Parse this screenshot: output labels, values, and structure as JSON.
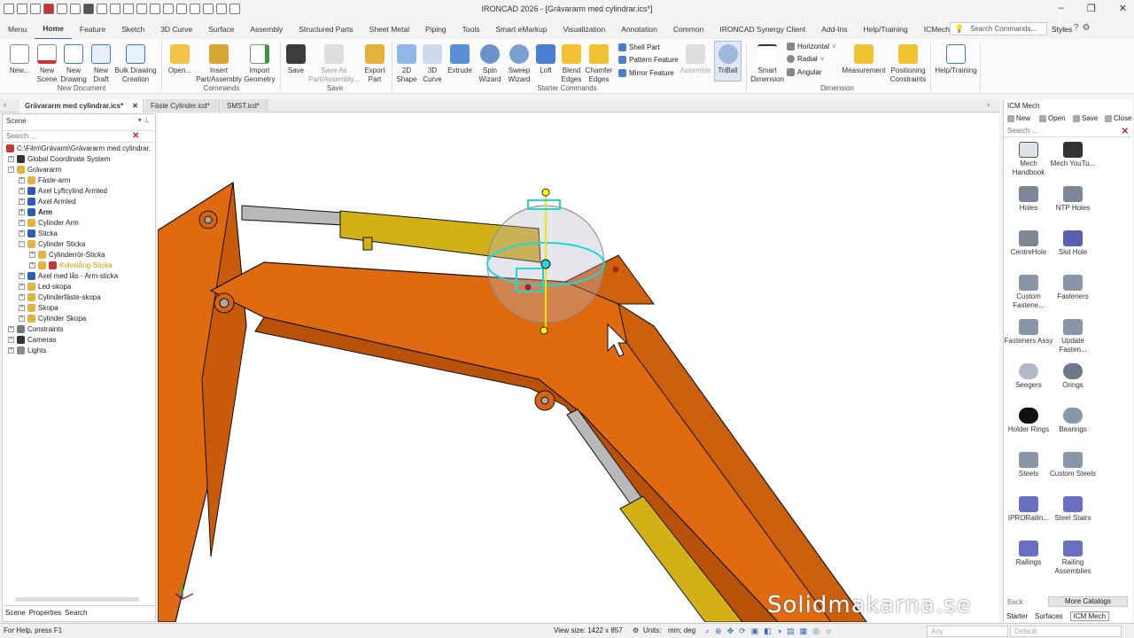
{
  "app": {
    "title": "IRONCAD 2026 - [Grävararm med cylindrar.ics*]"
  },
  "ribbon_tabs": [
    "Menu",
    "Home",
    "Feature",
    "Sketch",
    "3D Curve",
    "Surface",
    "Assembly",
    "Structured Parts",
    "Sheet Metal",
    "Piping",
    "Tools",
    "Smart eMarkup",
    "Visualization",
    "Annotation",
    "Common",
    "IRONCAD Synergy Client",
    "Add-Ins",
    "Help/Training",
    "ICMech"
  ],
  "search_commands": "Search Commands...",
  "styles_label": "Styles",
  "groups": {
    "new_document": {
      "label": "New Document",
      "buttons": [
        "New...",
        "New Scene",
        "New Drawing",
        "New Draft",
        "Bulk Drawing Creation"
      ]
    },
    "commands": {
      "label": "Commands",
      "buttons": [
        "Open...",
        "Insert Part/Assembly",
        "Import Geometry"
      ]
    },
    "save": {
      "label": "Save",
      "buttons": [
        "Save",
        "Save As Part/Assembly...",
        "Export Part"
      ]
    },
    "starter": {
      "label": "Starter Commands",
      "buttons": [
        "2D Shape",
        "3D Curve",
        "Extrude",
        "Spin Wizard",
        "Sweep Wizard",
        "Loft",
        "Blend Edges",
        "Chamfer Edges"
      ],
      "small": [
        "Shell Part",
        "Pattern Feature",
        "Mirror Feature"
      ],
      "assemble": "Assemble",
      "triball": "TriBall"
    },
    "dimension": {
      "label": "Dimension",
      "buttons": [
        "Smart Dimension",
        "Measurement",
        "Positioning Constraints"
      ],
      "small": [
        "Horizontal",
        "Radial",
        "Angular"
      ]
    },
    "help": {
      "buttons": [
        "Help/Training"
      ]
    }
  },
  "doc_tabs": [
    "Grävararm med cylindrar.ics*",
    "Fäste Cylinder.icd*",
    "SMST.icd*"
  ],
  "scene": {
    "title": "Scene",
    "search": "Search ...",
    "tree": [
      "C:\\Film\\Grävarm\\Grävararm med cylindrar.",
      "Global Coordinate System",
      "Grävararm",
      "Fäste-arm",
      "Axel Lyftcylind Armled",
      "Axel Armled",
      "Arm",
      "Cylinder Arm",
      "Sticka",
      "Cylinder Sticka",
      "Cylinderrör-Sticka",
      "Kolvstång-Sticka",
      "Axel med lås - Arm-sticka",
      "Led-skopa",
      "Cylinderfäste-skopa",
      "Skopa",
      "Cylinder Skopa",
      "Constraints",
      "Cameras",
      "Lights"
    ],
    "tabs": [
      "Scene",
      "Properties",
      "Search"
    ]
  },
  "icm": {
    "title": "ICM Mech",
    "buttons": [
      "New",
      "Open",
      "Save",
      "Close"
    ],
    "search": "Search ...",
    "items": [
      "Mech Handbook",
      "Mech YouTu...",
      "Holes",
      "NTP Holes",
      "CentreHole",
      "Slot Hole",
      "Custom Fastene...",
      "Fasteners",
      "Fasteners Assy",
      "Update Fasten...",
      "Seegers",
      "Orings",
      "Holder Rings",
      "Bearings",
      "Steels",
      "Custom Steels",
      "IPRORailin...",
      "Steel Stairs",
      "Railings",
      "Railing Assemblies"
    ],
    "back": "Back",
    "more": "More Catalogs",
    "footer_tabs": [
      "Starter",
      "Surfaces",
      "ICM Mech"
    ]
  },
  "status": {
    "help": "For Help, press F1",
    "view_size": "View size: 1422 x 857",
    "units_label": "Units:",
    "units": "mm; deg",
    "any": "Any",
    "default": "Default"
  },
  "watermark": "Solidmakarna.se",
  "colors": {
    "arm": "#e06a10",
    "arm_dark": "#b85208",
    "cylinder": "#d4b017",
    "rod": "#b9b9b9",
    "triball": "#22d6d6",
    "accent": "#2a6ad1"
  }
}
